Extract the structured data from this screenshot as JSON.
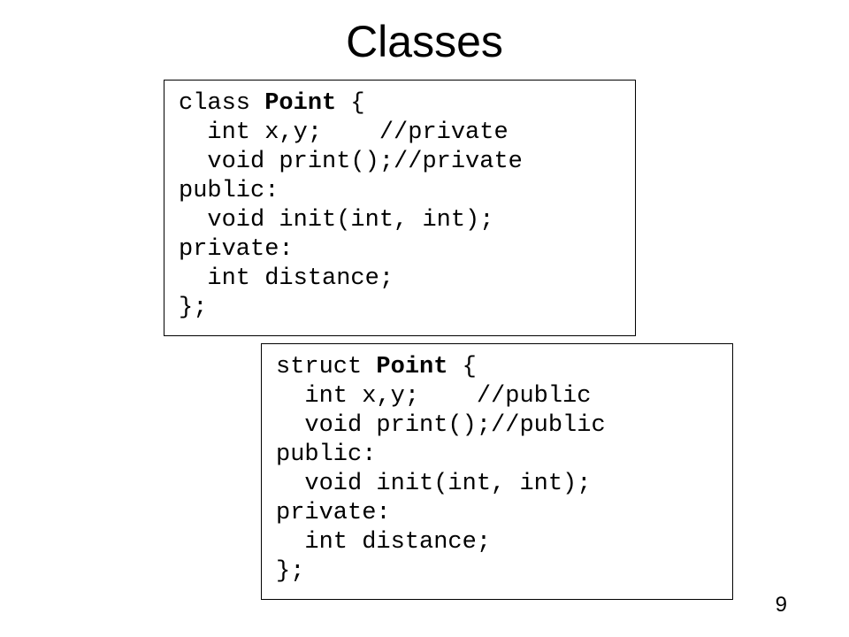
{
  "title": "Classes",
  "footer": "9",
  "code1": {
    "line1a": "class ",
    "line1b": "Point",
    "line1c": " {",
    "line2": "  int x,y;    //private",
    "line3": "  void print();//private",
    "line4": "public:",
    "line5": "  void init(int, int);",
    "line6": "private:",
    "line7": "  int distance;",
    "line8": "};"
  },
  "code2": {
    "line1a": "struct ",
    "line1b": "Point",
    "line1c": " {",
    "line2": "  int x,y;    //public",
    "line3": "  void print();//public",
    "line4": "public:",
    "line5": "  void init(int, int);",
    "line6": "private:",
    "line7": "  int distance;",
    "line8": "};"
  }
}
